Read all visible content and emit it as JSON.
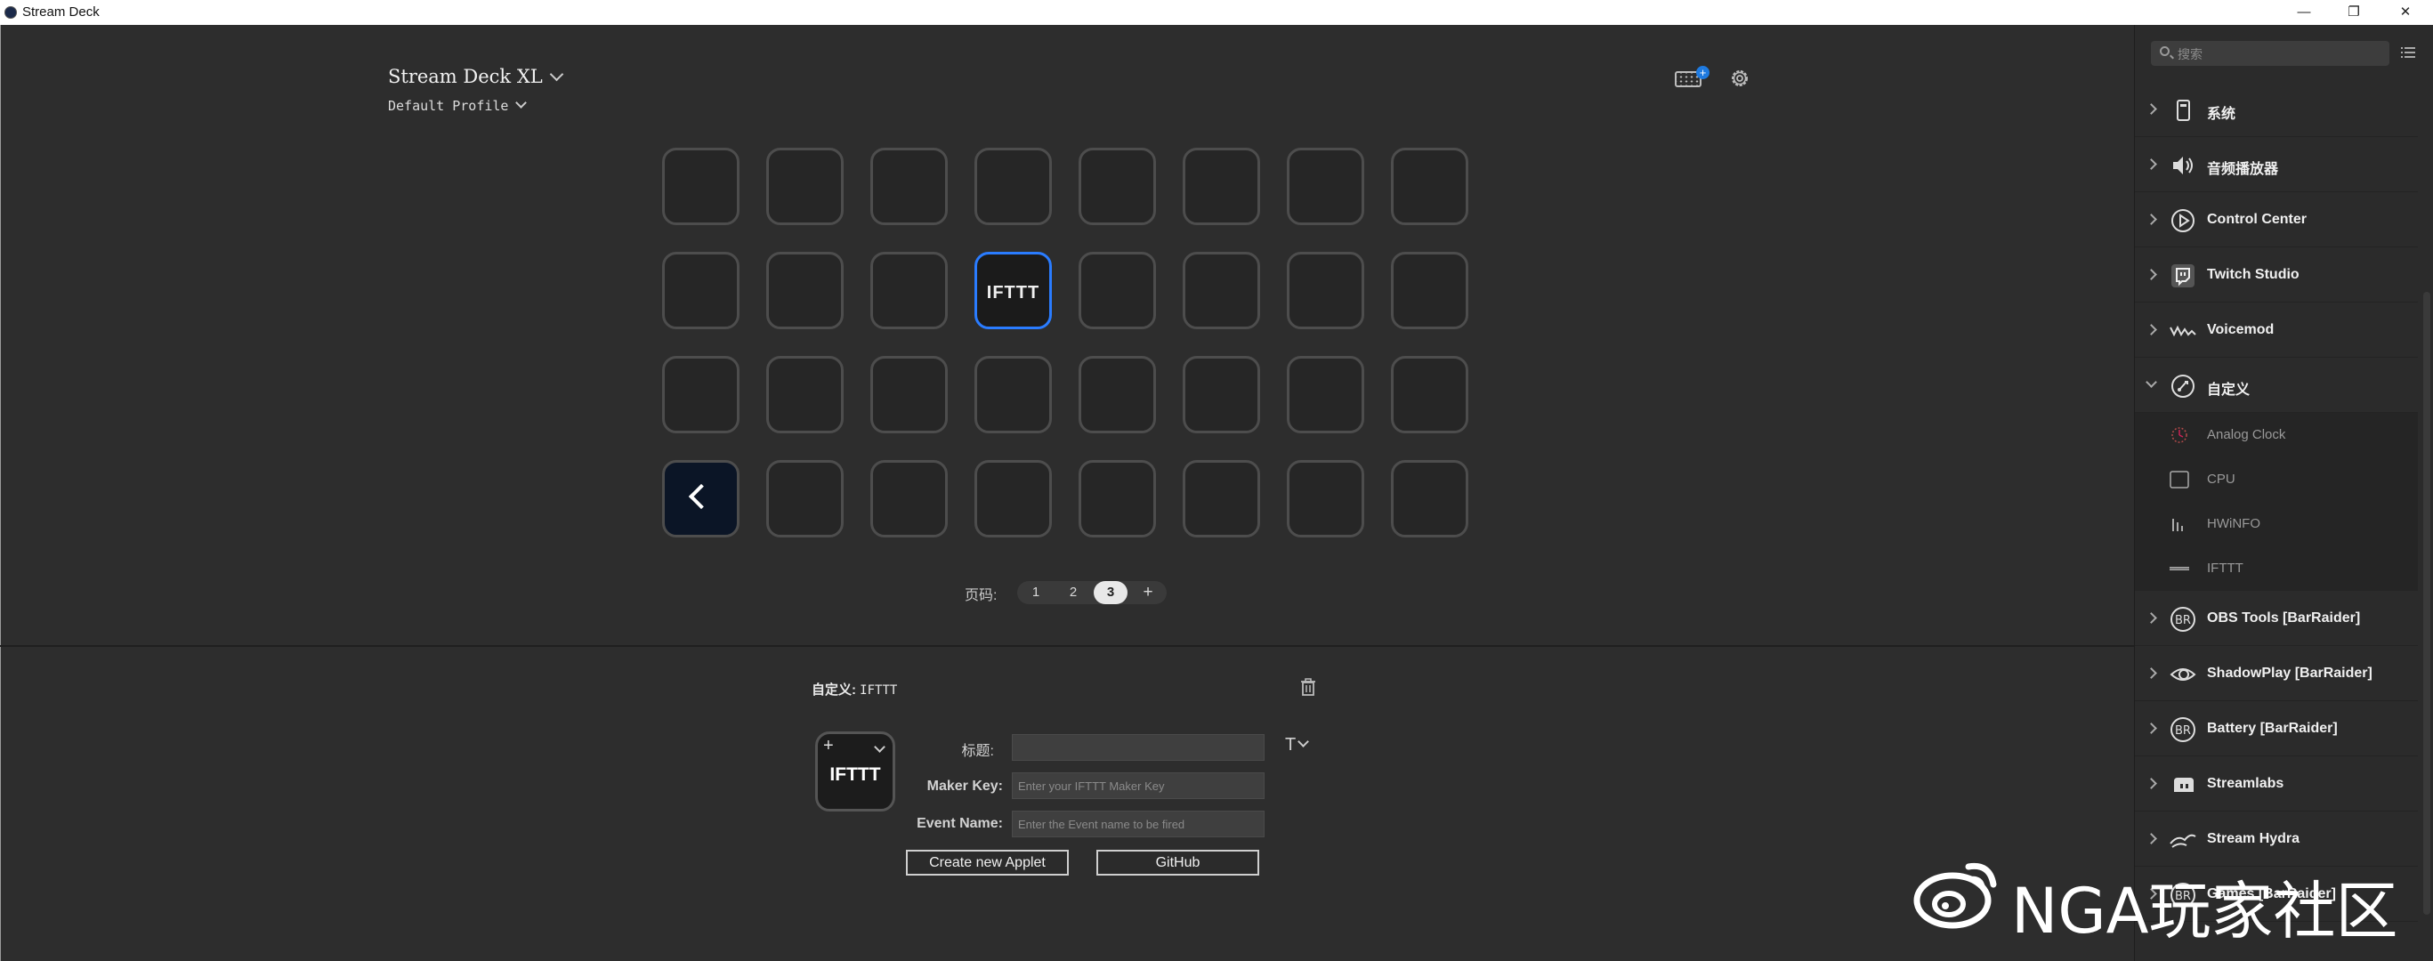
{
  "window": {
    "title": "Stream Deck",
    "controls": {
      "minimize": "—",
      "restore": "❐",
      "close": "✕"
    }
  },
  "header": {
    "device": "Stream Deck XL",
    "profile": "Default Profile",
    "keyboard_badge": "+"
  },
  "grid": {
    "keys": [
      [
        "",
        "",
        "",
        "",
        "",
        "",
        "",
        ""
      ],
      [
        "",
        "",
        "",
        "IFTTT",
        "",
        "",
        "",
        ""
      ],
      [
        "",
        "",
        "",
        "",
        "",
        "",
        "",
        ""
      ],
      [
        "back",
        "",
        "",
        "",
        "",
        "",
        "",
        ""
      ]
    ],
    "selected": "IFTTT"
  },
  "pager": {
    "label": "页码:",
    "pages": [
      "1",
      "2",
      "3"
    ],
    "active": "3",
    "add": "+"
  },
  "inspector": {
    "title_prefix": "自定义:",
    "title_value": "IFTTT",
    "preview_label": "IFTTT",
    "preview_plus": "+",
    "fields": {
      "title_label": "标题:",
      "title_value": "",
      "maker_key_label": "Maker Key:",
      "maker_key_placeholder": "Enter your IFTTT Maker Key",
      "event_name_label": "Event Name:",
      "event_name_placeholder": "Enter the Event name to be fired"
    },
    "title_style_glyph": "T",
    "buttons": {
      "create": "Create new Applet",
      "github": "GitHub"
    }
  },
  "sidebar": {
    "search_placeholder": "搜索",
    "categories_top": [
      {
        "name": "系统",
        "icon": "device-icon",
        "expanded": false
      },
      {
        "name": "音频播放器",
        "icon": "speaker-icon",
        "expanded": false
      },
      {
        "name": "Control Center",
        "icon": "control-center-icon",
        "expanded": false
      },
      {
        "name": "Twitch Studio",
        "icon": "twitch-icon",
        "expanded": false
      },
      {
        "name": "Voicemod",
        "icon": "voicemod-icon",
        "expanded": false
      },
      {
        "name": "自定义",
        "icon": "custom-icon",
        "expanded": true
      }
    ],
    "custom_items": [
      {
        "name": "Analog Clock",
        "icon": "clock-icon"
      },
      {
        "name": "CPU",
        "icon": "cpu-icon"
      },
      {
        "name": "HWiNFO",
        "icon": "bars-icon"
      },
      {
        "name": "IFTTT",
        "icon": "ifttt-icon"
      }
    ],
    "categories_bottom": [
      {
        "name": "OBS Tools [BarRaider]",
        "icon": "barraider-icon"
      },
      {
        "name": "ShadowPlay [BarRaider]",
        "icon": "nvidia-icon"
      },
      {
        "name": "Battery [BarRaider]",
        "icon": "barraider-icon"
      },
      {
        "name": "Streamlabs",
        "icon": "streamlabs-icon"
      },
      {
        "name": "Stream Hydra",
        "icon": "hydra-icon"
      },
      {
        "name": "Games [BarRaider]",
        "icon": "barraider-icon"
      }
    ]
  },
  "watermark": {
    "text": "NGA玩家社区",
    "icon": "weibo-icon"
  },
  "colors": {
    "accent": "#2a7cff",
    "background": "#2d2d2d",
    "sidebar": "#2b2b2b"
  }
}
